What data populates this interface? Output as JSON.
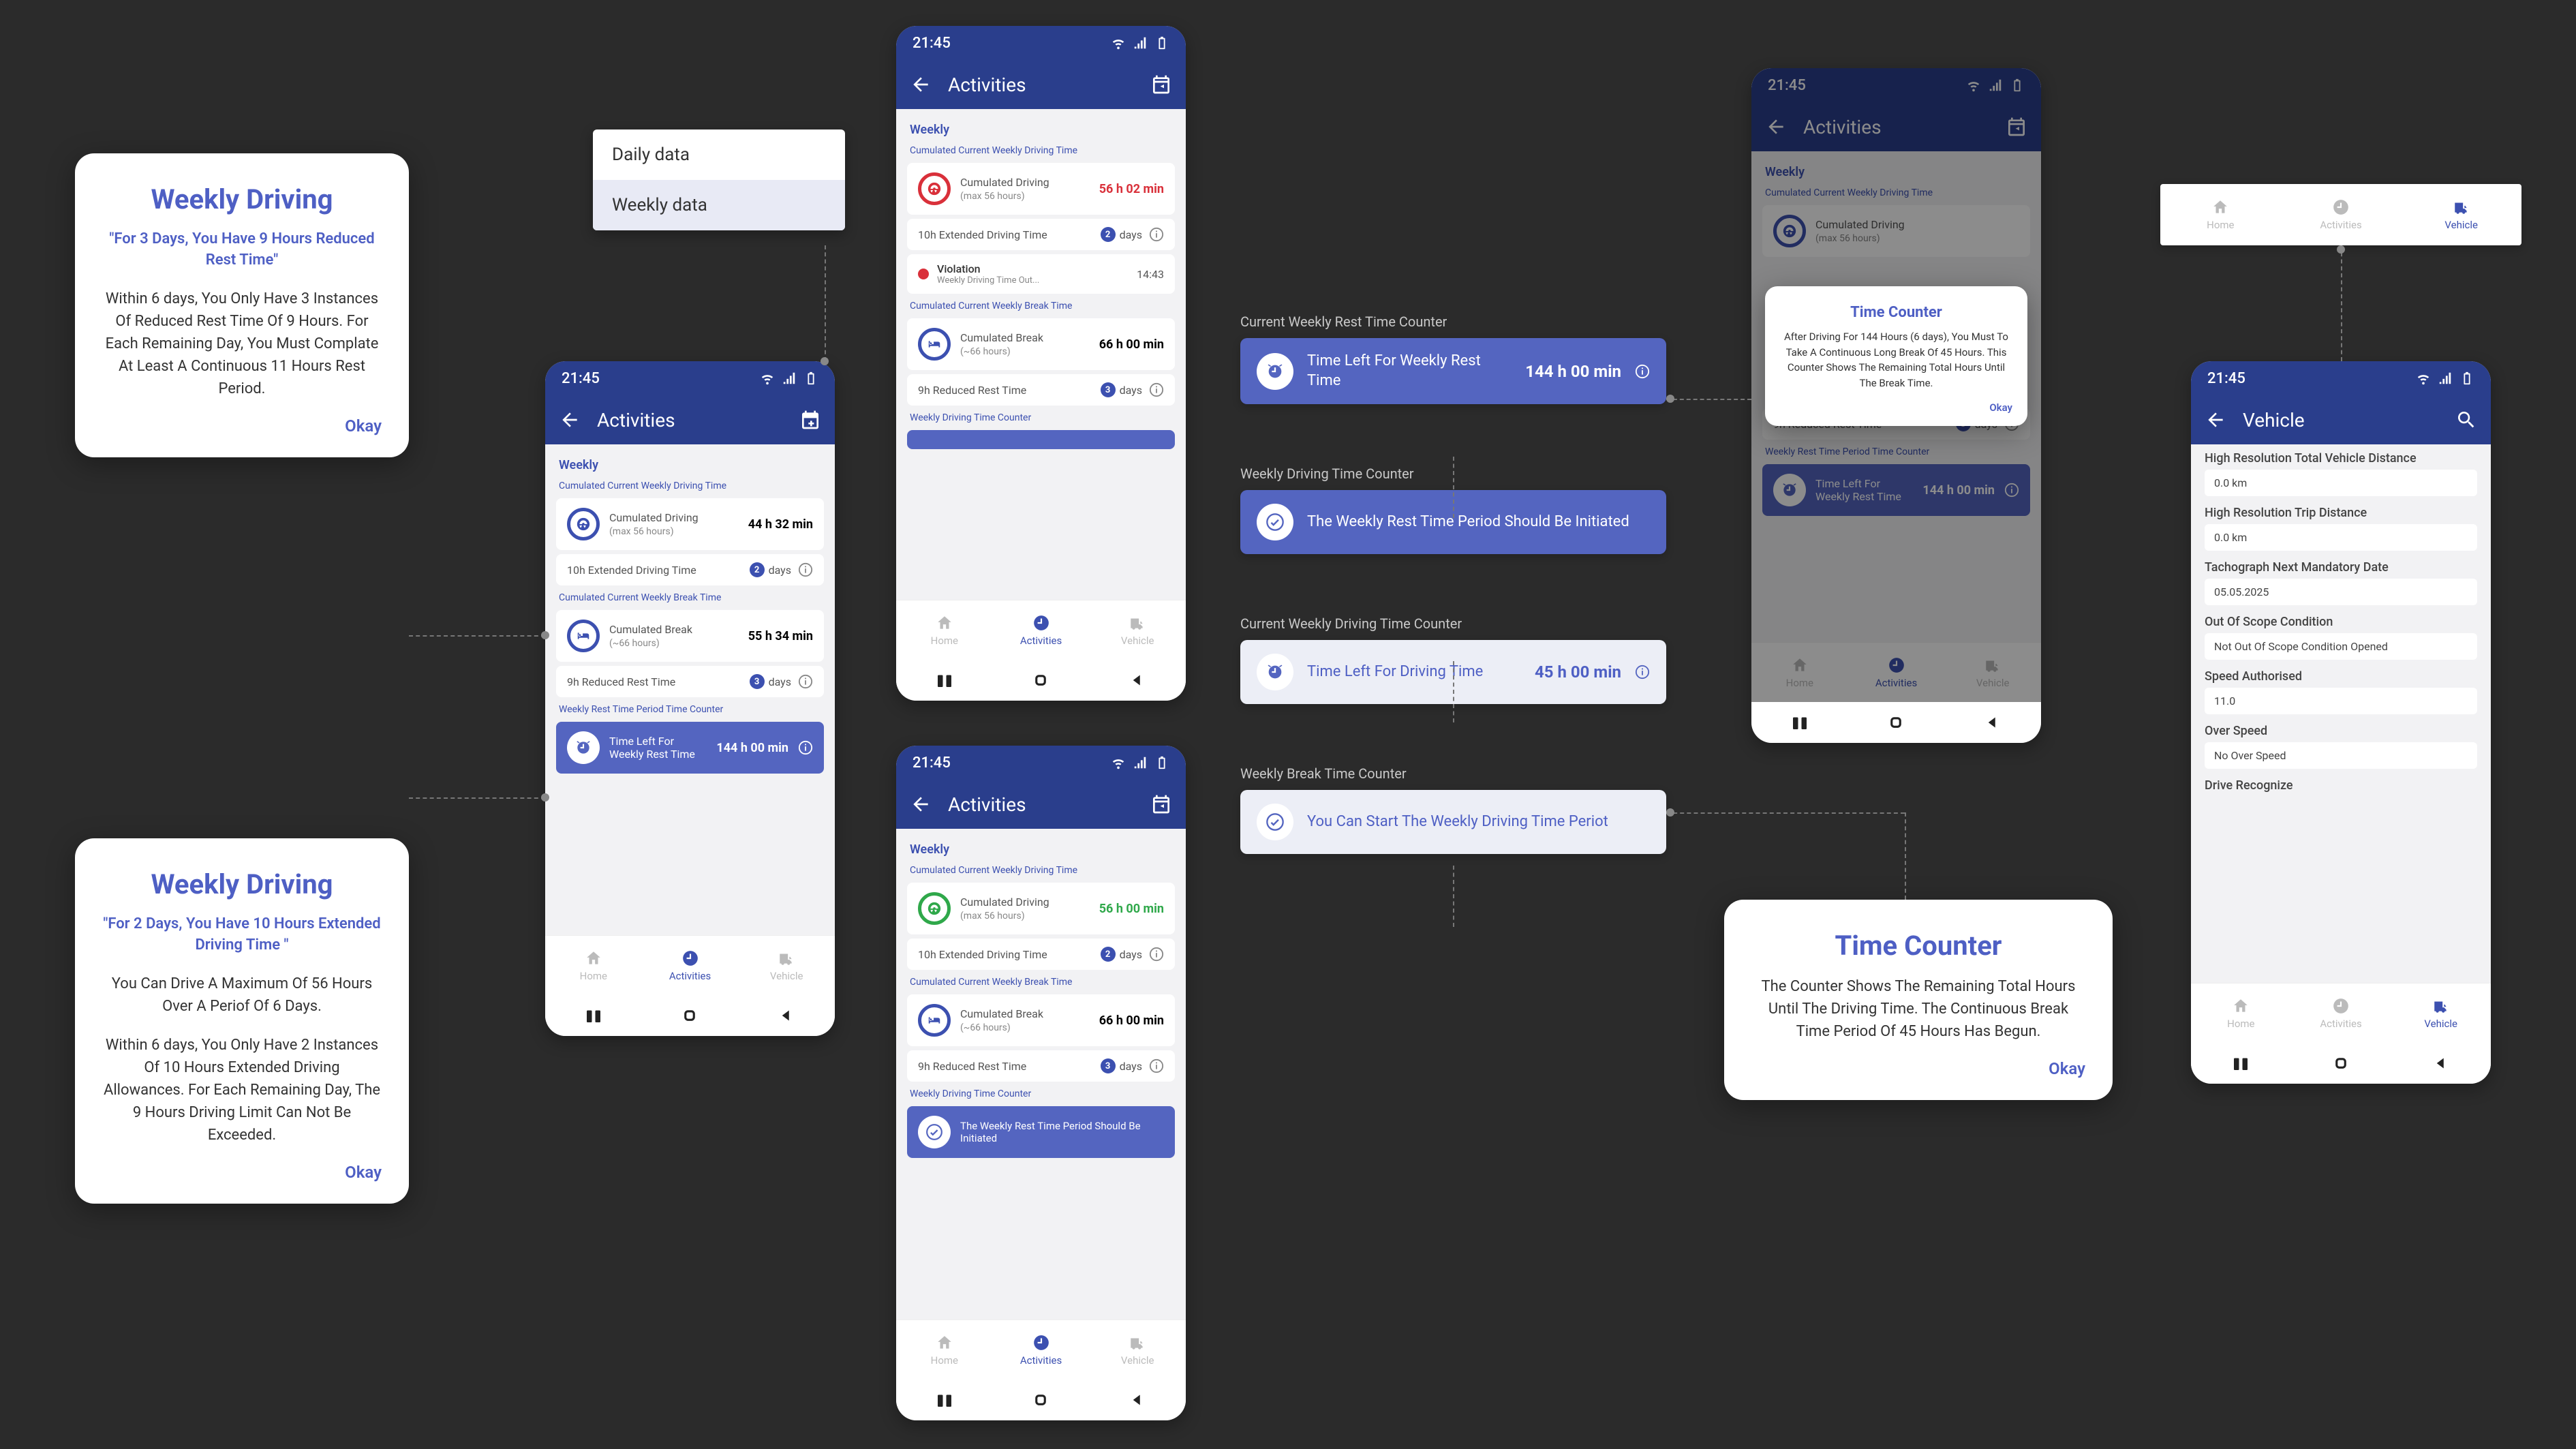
{
  "statusbar_time": "21:45",
  "dialog1": {
    "title": "Weekly Driving",
    "quote": "\"For 3 Days, You Have 9 Hours Reduced Rest Time\"",
    "body": "Within 6 days, You Only Have 3 Instances Of Reduced Rest Time Of 9 Hours. For Each Remaining Day, You Must Complate At Least A Continuous 11 Hours Rest Period.",
    "ok": "Okay"
  },
  "dialog2": {
    "title": "Weekly Driving",
    "quote": "\"For 2 Days, You Have 10 Hours Extended Driving Time \"",
    "body1": "You Can Drive A Maximum Of 56 Hours Over A Periof Of 6 Days.",
    "body2": "Within 6 days, You Only Have 2 Instances Of 10 Hours Extended Driving Allowances. For Each Remaining Day, The 9 Hours Driving Limit Can Not Be Exceeded.",
    "ok": "Okay"
  },
  "dialog3": {
    "title": "Time Counter",
    "body": "The Counter Shows The Remaining Total Hours Until The Driving Time. The Continuous Break Time Period Of 45 Hours Has Begun.",
    "ok": "Okay"
  },
  "dialog4": {
    "title": "Time Counter",
    "body": "After Driving For 144 Hours (6 days), You Must To Take A Continuous Long Break Of 45 Hours. This Counter Shows The Remaining Total Hours Until The Break Time.",
    "ok": "Okay"
  },
  "menu": {
    "daily": "Daily data",
    "weekly": "Weekly data"
  },
  "nav": {
    "home": "Home",
    "activities": "Activities",
    "vehicle": "Vehicle"
  },
  "appbar": {
    "activities": "Activities",
    "vehicle": "Vehicle"
  },
  "sections": {
    "weekly": "Weekly",
    "cum_drive": "Cumulated Current Weekly Driving Time",
    "cum_break": "Cumulated Current Weekly Break Time",
    "rest_counter": "Weekly Rest Time Period Time Counter",
    "drive_counter": "Weekly Driving Time Counter"
  },
  "cards": {
    "cum_drive_lbl": "Cumulated Driving",
    "cum_drive_sub": "(max 56 hours)",
    "cum_break_lbl": "Cumulated Break",
    "cum_break_sub": "(~66 hours)",
    "ext_drive": "10h Extended Driving Time",
    "ext_val": "2",
    "ext_unit": "days",
    "reduced_rest": "9h Reduced Rest Time",
    "reduced_val": "3",
    "reduced_unit": "days",
    "time_left_rest": "Time Left For Weekly Rest Time",
    "time_left_rest_val": "144 h 00 min",
    "violation": "Violation",
    "violation_sub": "Weekly Driving Time Out...",
    "violation_time": "14:43",
    "weekly_rest_init": "The Weekly Rest Time Period Should Be Initiated"
  },
  "phoneA": {
    "drive_val": "44 h 32 min",
    "break_val": "55 h 34 min"
  },
  "phoneB": {
    "drive_val": "56 h 02 min",
    "break_val": "66 h 00 min"
  },
  "phoneC": {
    "drive_val": "56 h 00 min",
    "break_val": "66 h 00 min"
  },
  "standalone": {
    "s1_label": "Current Weekly Rest Time Counter",
    "s1_txt": "Time Left For Weekly Rest Time",
    "s1_val": "144 h 00 min",
    "s2_label": "Weekly Driving Time Counter",
    "s2_txt": "The Weekly Rest Time Period Should Be Initiated",
    "s3_label": "Current Weekly Driving Time Counter",
    "s3_txt": "Time Left For Driving Time",
    "s3_val": "45 h 00 min",
    "s4_label": "Weekly Break Time Counter",
    "s4_txt": "You Can Start The Weekly Driving Time Periot"
  },
  "vehicle": {
    "hr_total": {
      "k": "High Resolution Total Vehicle Distance",
      "v": "0.0 km"
    },
    "hr_trip": {
      "k": "High Resolution Trip Distance",
      "v": "0.0 km"
    },
    "tacho": {
      "k": "Tachograph Next Mandatory Date",
      "v": "05.05.2025"
    },
    "oos": {
      "k": "Out Of Scope Condition",
      "v": "Not Out Of Scope Condition Opened"
    },
    "speed": {
      "k": "Speed Authorised",
      "v": "11.0"
    },
    "overspeed": {
      "k": "Over Speed",
      "v": "No Over Speed"
    },
    "drec": {
      "k": "Drive Recognize"
    }
  }
}
